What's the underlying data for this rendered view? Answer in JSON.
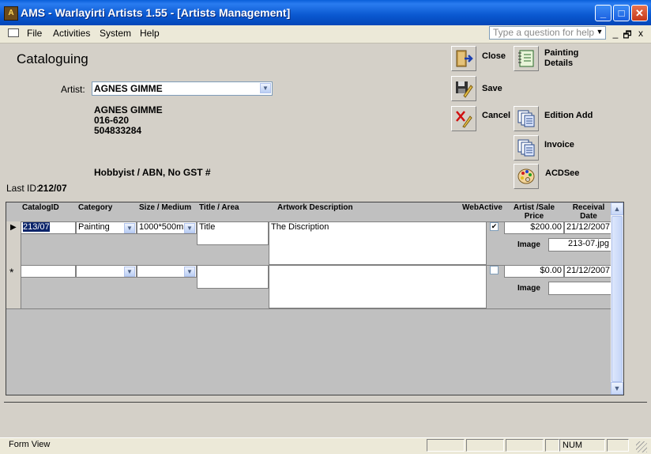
{
  "window": {
    "title": "AMS - Warlayirti Artists 1.55 - [Artists Management]",
    "app_icon": "ams-app-icon",
    "controls": [
      "_",
      "□",
      "✕"
    ]
  },
  "menubar": {
    "items": [
      {
        "label": "File"
      },
      {
        "label": "Activities"
      },
      {
        "label": "System"
      },
      {
        "label": "Help"
      }
    ],
    "help_placeholder": "Type a question for help",
    "mdi_controls": [
      "_",
      "🗗",
      "x"
    ]
  },
  "form": {
    "title": "Cataloguing",
    "artist_label": "Artist:",
    "artist_value": "AGNES GIMME",
    "artist_details": {
      "name": "AGNES GIMME",
      "line2": "016-620",
      "line3": "504833284"
    },
    "status_text": "Hobbyist / ABN, No GST #",
    "last_id_label": "Last ID:",
    "last_id_value": "212/07"
  },
  "buttons": {
    "close": "Close",
    "save": "Save",
    "cancel": "Cancel",
    "painting_details_1": "Painting",
    "painting_details_2": "Details",
    "edition_add": "Edition Add",
    "invoice": "Invoice",
    "acdsee": "ACDSee"
  },
  "grid": {
    "headers": {
      "catalog_id": "CatalogID",
      "category": "Category",
      "size_medium": "Size / Medium",
      "title_area": "Title / Area",
      "artwork_description": "Artwork Description",
      "webactive": "WebActive",
      "artist_sale_price_1": "Artist /Sale",
      "artist_sale_price_2": "Price",
      "receival_date_1": "Receival",
      "receival_date_2": "Date"
    },
    "rows": [
      {
        "selector": "▶",
        "catalog_id": "213/07",
        "category": "Painting",
        "size_medium": "1000*500mm",
        "title": "Title",
        "description": "The Discription",
        "webactive": "✔",
        "price": "$200.00",
        "receival_date": "21/12/2007",
        "image_label": "Image",
        "image_value": "213-07.jpg"
      },
      {
        "selector": "*",
        "catalog_id": "",
        "category": "",
        "size_medium": "",
        "title": "",
        "description": "",
        "webactive": "",
        "price": "$0.00",
        "receival_date": "21/12/2007",
        "image_label": "Image",
        "image_value": ""
      }
    ]
  },
  "statusbar": {
    "mode": "Form View",
    "num": "NUM"
  }
}
